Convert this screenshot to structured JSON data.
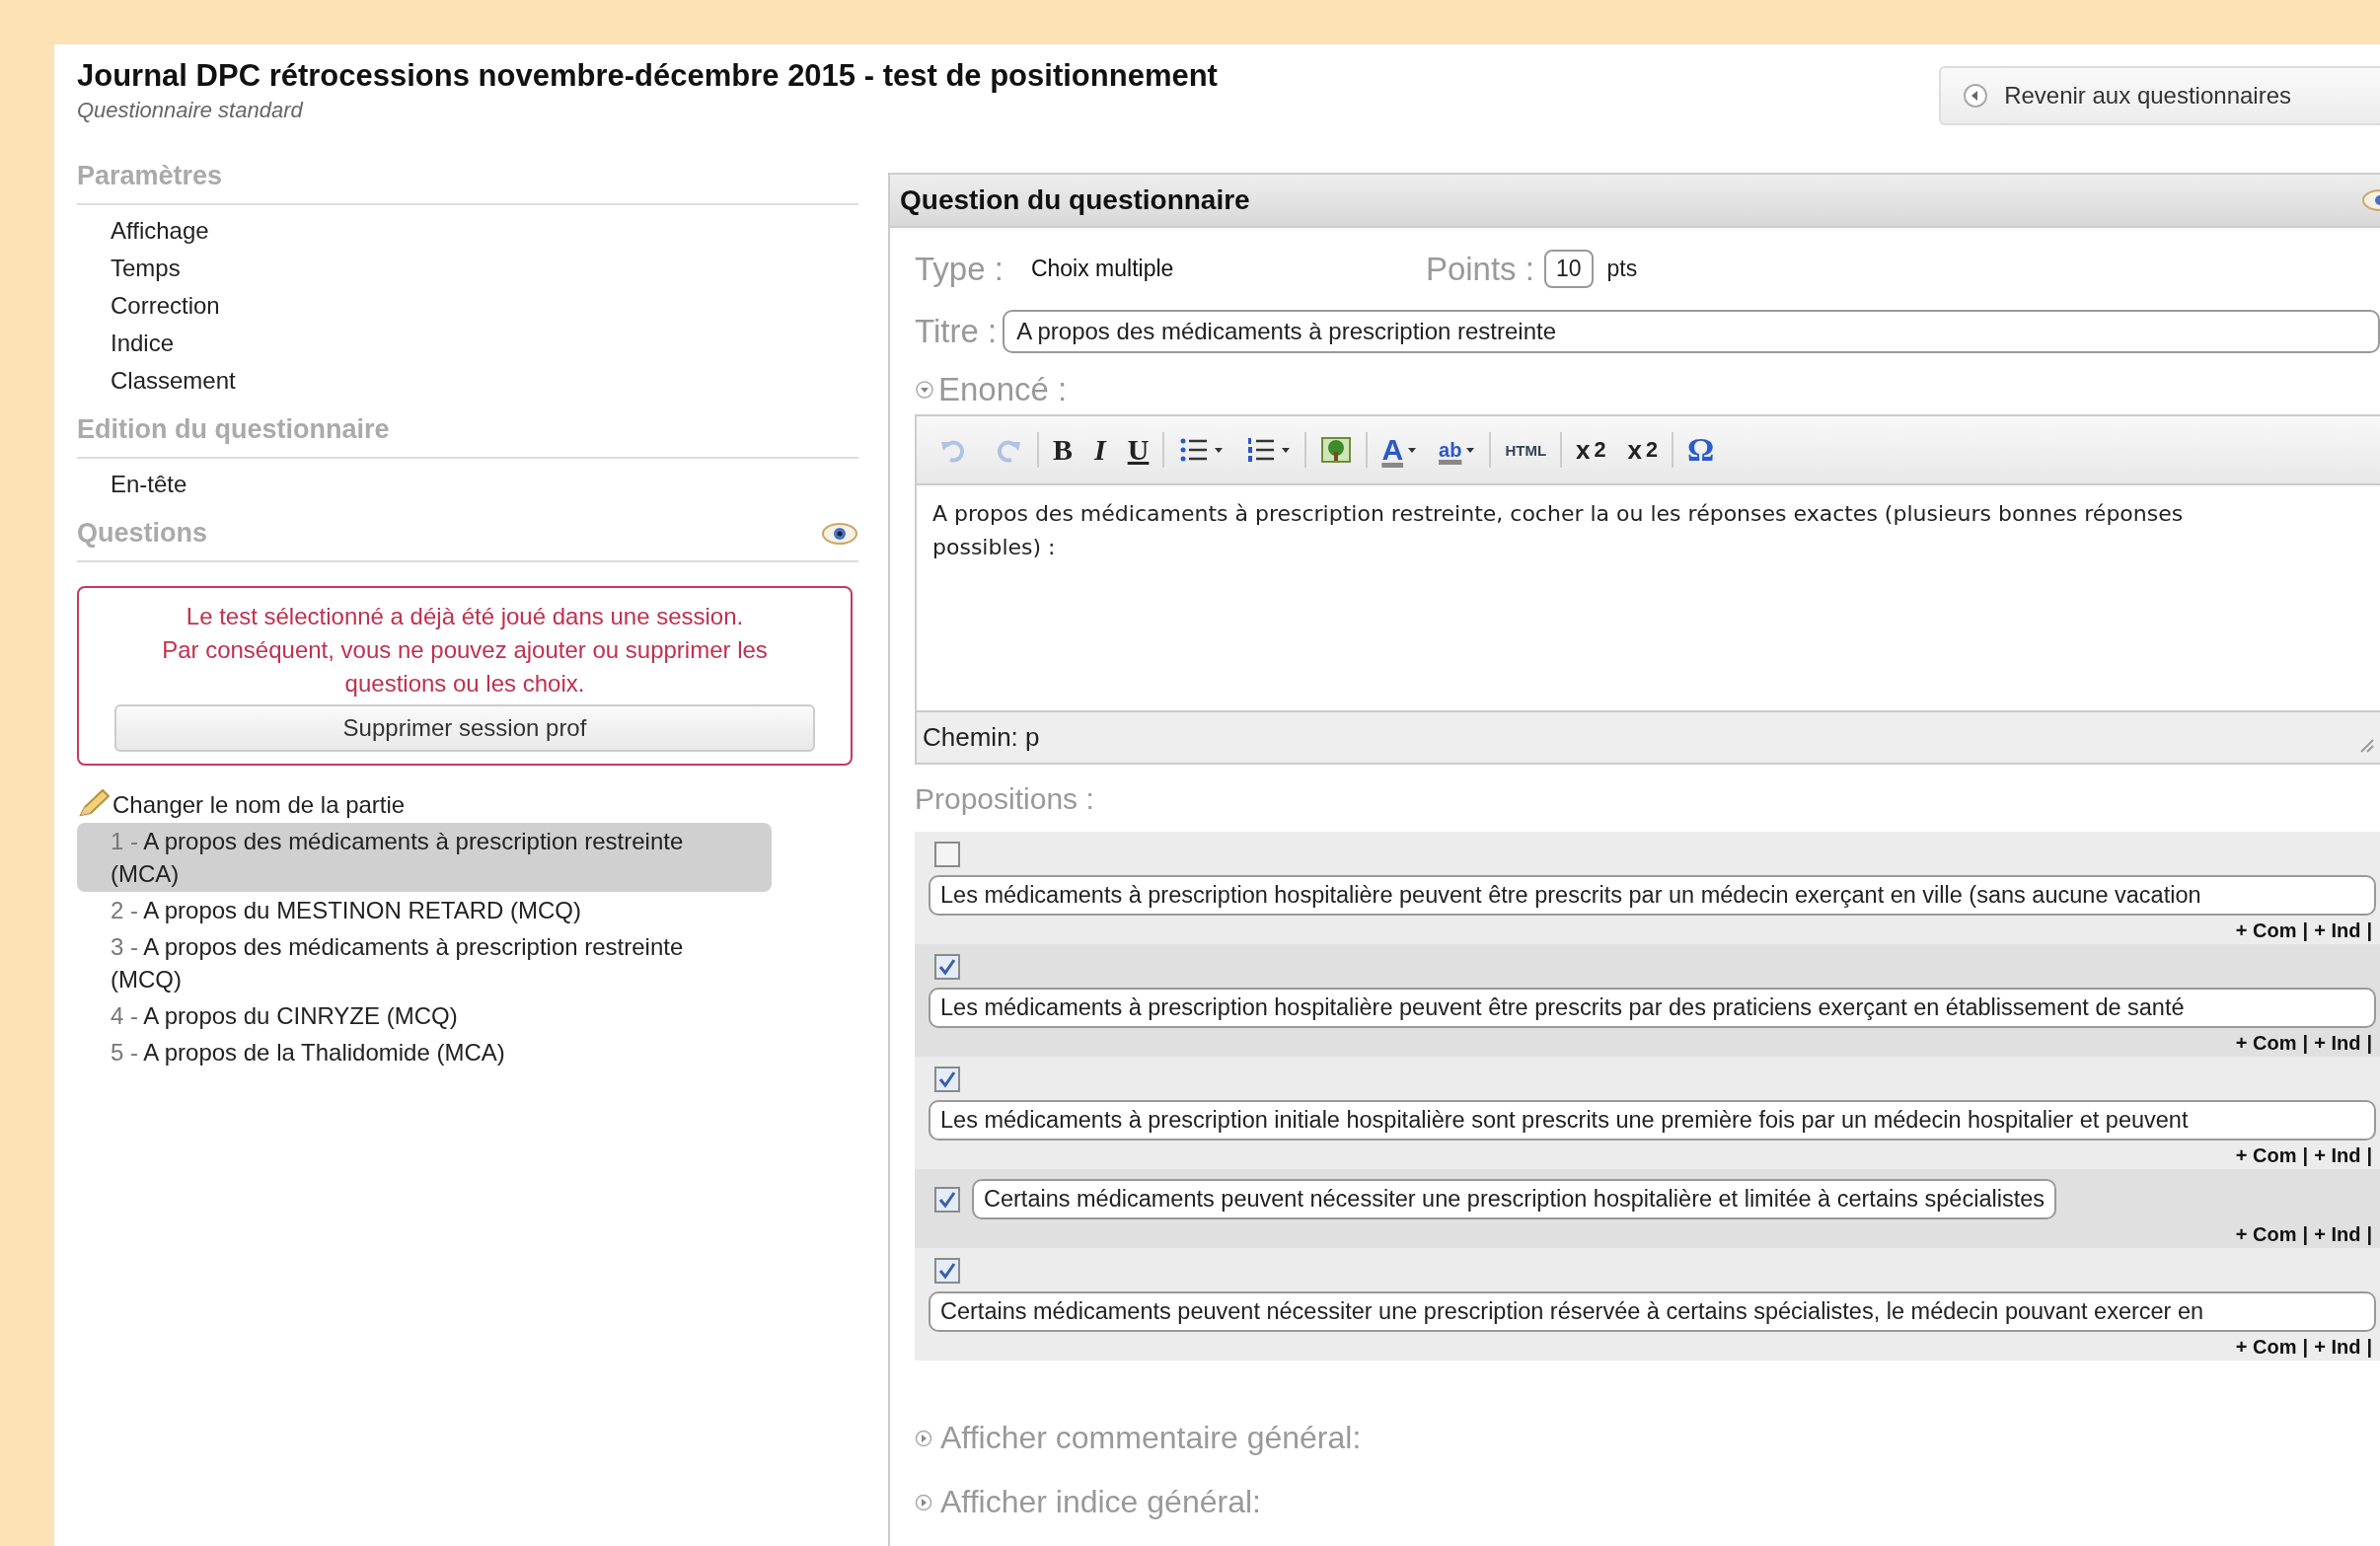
{
  "header": {
    "title": "Journal DPC rétrocessions novembre-décembre 2015 - test de positionnement",
    "subtitle": "Questionnaire standard",
    "back_button": "Revenir aux questionnaires"
  },
  "sidebar": {
    "sections": [
      {
        "heading": "Paramètres",
        "items": [
          "Affichage",
          "Temps",
          "Correction",
          "Indice",
          "Classement"
        ]
      },
      {
        "heading": "Edition du questionnaire",
        "items": [
          "En-tête"
        ]
      },
      {
        "heading": "Questions",
        "eye": true
      }
    ],
    "alert": {
      "lines": [
        "Le test sélectionné a déjà été joué dans une session.",
        "Par conséquent, vous ne pouvez ajouter ou supprimer les questions ou les choix."
      ],
      "button": "Supprimer session prof"
    },
    "rename_link": "Changer le nom de la partie",
    "questions": [
      {
        "number": "1 -",
        "text": "A propos des médicaments à prescription restreinte (MCA)",
        "selected": true
      },
      {
        "number": "2 -",
        "text": "A propos du MESTINON RETARD (MCQ)",
        "selected": false
      },
      {
        "number": "3 -",
        "text": "A propos des médicaments à prescription restreinte (MCQ)",
        "selected": false
      },
      {
        "number": "4 -",
        "text": "A propos du CINRYZE (MCQ)",
        "selected": false
      },
      {
        "number": "5 -",
        "text": "A propos de la Thalidomide (MCA)",
        "selected": false
      }
    ]
  },
  "panel": {
    "title": "Question du questionnaire",
    "type_label": "Type :",
    "type_value": "Choix multiple",
    "points_label": "Points :",
    "points_value": "10",
    "points_unit": "pts",
    "title_label": "Titre :",
    "title_value": "A propos des médicaments à prescription restreinte",
    "statement_label": "Enoncé :",
    "statement_expanded": true,
    "toolbar": [
      {
        "kind": "undo",
        "disabled": true
      },
      {
        "kind": "redo",
        "disabled": true
      },
      {
        "kind": "sep"
      },
      {
        "kind": "bold",
        "label": "B"
      },
      {
        "kind": "italic",
        "label": "I"
      },
      {
        "kind": "underline",
        "label": "U"
      },
      {
        "kind": "sep"
      },
      {
        "kind": "bullets"
      },
      {
        "kind": "numbers"
      },
      {
        "kind": "sep"
      },
      {
        "kind": "image"
      },
      {
        "kind": "sep"
      },
      {
        "kind": "color",
        "label": "A"
      },
      {
        "kind": "highlight",
        "label": "ab"
      },
      {
        "kind": "sep"
      },
      {
        "kind": "html",
        "label": "HTML"
      },
      {
        "kind": "sep"
      },
      {
        "kind": "sub",
        "label": "x",
        "small": "2"
      },
      {
        "kind": "sup",
        "label": "x",
        "small": "2"
      },
      {
        "kind": "sep"
      },
      {
        "kind": "symbol",
        "label": "Ω"
      }
    ],
    "editor_text": "A propos des médicaments à prescription restreinte, cocher la ou les réponses exactes (plusieurs bonnes réponses possibles) :",
    "path": "Chemin: p",
    "propositions_label": "Propositions :",
    "separator": "|",
    "propositions": [
      {
        "kind": "stacked",
        "checked": false,
        "text": "Les médicaments à prescription hospitalière peuvent être prescrits par un médecin exerçant en ville (sans aucune vacation",
        "links": [
          "+ Com",
          "+ Ind"
        ]
      },
      {
        "kind": "stacked",
        "checked": true,
        "text": "Les médicaments à prescription hospitalière peuvent être prescrits par des praticiens exerçant en établissement de santé",
        "links": [
          "+ Com",
          "+ Ind"
        ]
      },
      {
        "kind": "stacked",
        "checked": true,
        "text": "Les médicaments à prescription initiale hospitalière sont prescrits une première fois par un médecin hospitalier et peuvent",
        "links": [
          "+ Com",
          "+ Ind"
        ]
      },
      {
        "kind": "inline",
        "checked": true,
        "text": "Certains médicaments peuvent nécessiter une prescription hospitalière et limitée à certains spécialistes",
        "links": [
          "+ Com",
          "+ Ind"
        ]
      },
      {
        "kind": "stacked",
        "checked": true,
        "text": "Certains médicaments peuvent nécessiter une prescription réservée à certains spécialistes, le médecin pouvant exercer en",
        "links": [
          "+ Com",
          "+ Ind"
        ]
      }
    ],
    "toggles": [
      {
        "label": "Afficher commentaire général:",
        "expanded": false
      },
      {
        "label": "Afficher indice général:",
        "expanded": false
      }
    ]
  }
}
